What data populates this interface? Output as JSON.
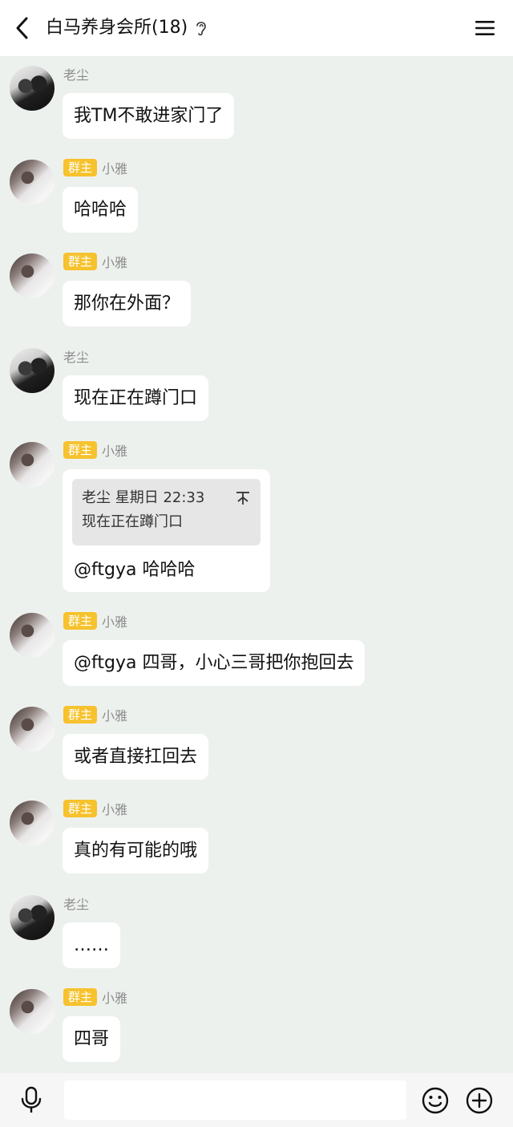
{
  "header": {
    "title": "白马养身会所(18)"
  },
  "messages": [
    {
      "sender": "老尘",
      "owner": "",
      "text": "我TM不敢进家门了"
    },
    {
      "sender": "小雅",
      "owner": "群主",
      "text": "哈哈哈"
    },
    {
      "sender": "小雅",
      "owner": "群主",
      "text": "那你在外面？"
    },
    {
      "sender": "老尘",
      "owner": "",
      "text": "现在正在蹲门口"
    },
    {
      "sender": "小雅",
      "owner": "群主",
      "quote_head": "老尘 星期日 22:33",
      "quote_text": "现在正在蹲门口",
      "text": "@ftgya 哈哈哈"
    },
    {
      "sender": "小雅",
      "owner": "群主",
      "text": "@ftgya 四哥，小心三哥把你抱回去"
    },
    {
      "sender": "小雅",
      "owner": "群主",
      "text": "或者直接扛回去"
    },
    {
      "sender": "小雅",
      "owner": "群主",
      "text": "真的有可能的哦"
    },
    {
      "sender": "老尘",
      "owner": "",
      "text": "……"
    },
    {
      "sender": "小雅",
      "owner": "群主",
      "text": "四哥"
    }
  ],
  "input": {
    "placeholder": "",
    "value": ""
  },
  "colors": {
    "owner_badge": "#f6c22d",
    "chat_bg": "#edf1ee",
    "bubble": "#ffffff"
  }
}
